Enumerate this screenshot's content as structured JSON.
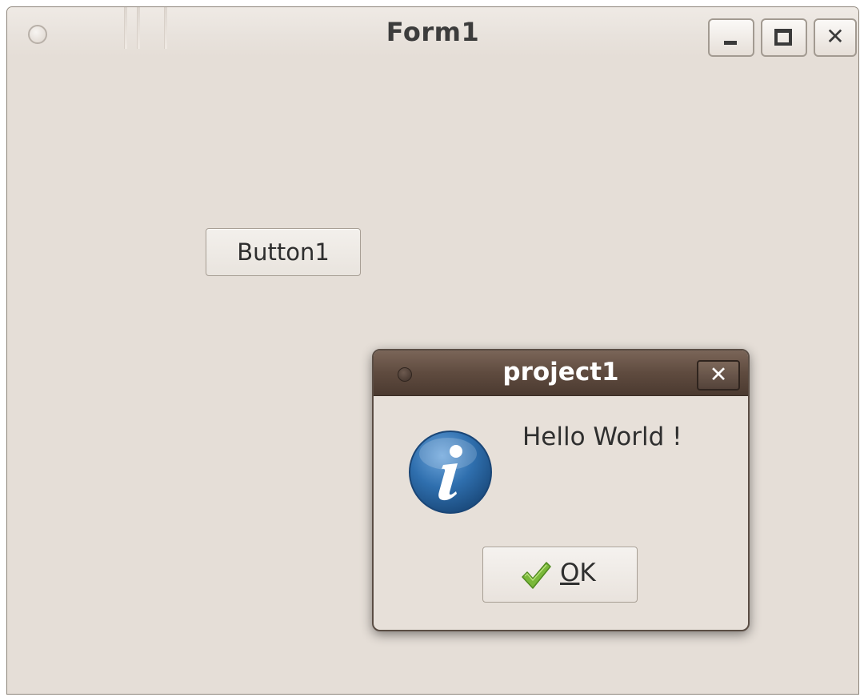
{
  "form_window": {
    "title": "Form1",
    "controls": {
      "menu_icon": "window-menu-icon",
      "minimize_icon": "minimize-icon",
      "maximize_icon": "maximize-icon",
      "close_icon": "close-icon",
      "close_glyph": "✕"
    },
    "button1_label": "Button1",
    "background_color": "#e5ded7"
  },
  "dialog": {
    "title": "project1",
    "close_glyph": "✕",
    "message": "Hello World !",
    "icon": "info-icon",
    "ok_button": {
      "mnemonic": "O",
      "rest": "K",
      "icon": "checkmark-icon"
    },
    "titlebar_color": "#5f4b3f",
    "icon_color": "#2f6fae"
  }
}
